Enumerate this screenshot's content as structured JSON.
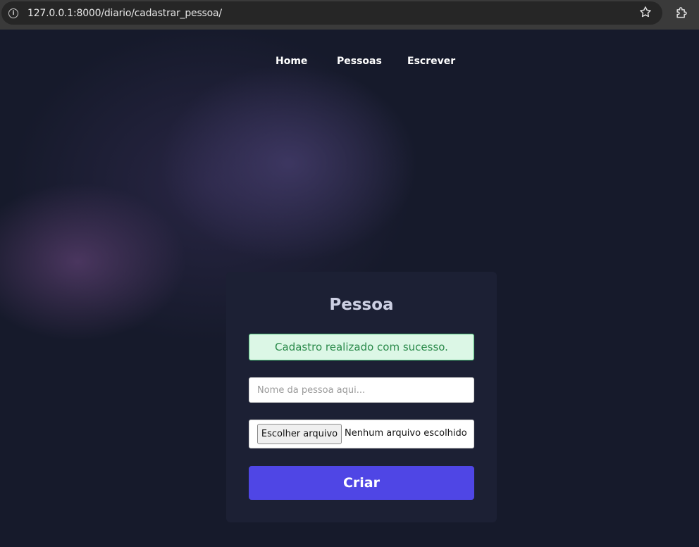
{
  "browser": {
    "url": "127.0.0.1:8000/diario/cadastrar_pessoa/",
    "info_icon": "info-icon",
    "bookmark_icon": "star-icon",
    "extensions_icon": "puzzle-icon"
  },
  "nav": {
    "items": [
      {
        "label": "Home"
      },
      {
        "label": "Pessoas"
      },
      {
        "label": "Escrever"
      }
    ]
  },
  "form": {
    "title": "Pessoa",
    "success_message": "Cadastro realizado com sucesso.",
    "name_placeholder": "Nome da pessoa aqui...",
    "name_value": "",
    "file_button_label": "Escolher arquivo",
    "file_status": "Nenhum arquivo escolhido",
    "submit_label": "Criar"
  },
  "colors": {
    "accent": "#4f46e5",
    "success_bg": "#dcf7e6",
    "success_text": "#2a8a4a",
    "background": "#161a2b"
  }
}
